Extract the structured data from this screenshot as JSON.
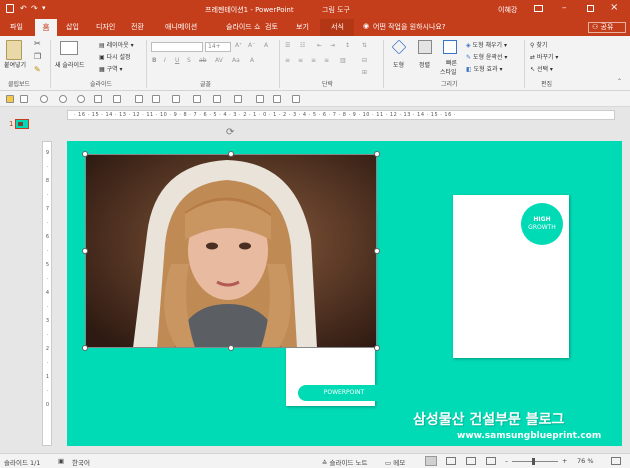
{
  "title": {
    "doc_title": "프레젠테이션1 - PowerPoint",
    "context_tab": "그림 도구",
    "user": "이혜강"
  },
  "tabs": {
    "file": "파일",
    "home": "홈",
    "insert": "삽입",
    "design": "디자인",
    "transitions": "전환",
    "animations": "애니메이션",
    "slideshow": "슬라이드 쇼",
    "review": "검토",
    "view": "보기",
    "format": "서식",
    "tell_me": "어떤 작업을 원하시나요?",
    "share": "공유"
  },
  "ribbon": {
    "clipboard": {
      "paste": "붙여넣기",
      "label": "클립보드"
    },
    "slides": {
      "new_slide": "새 슬라이드",
      "layout": "레이아웃",
      "reset": "다시 설정",
      "section": "구역",
      "label": "슬라이드"
    },
    "font": {
      "size": "14+",
      "label": "글꼴"
    },
    "paragraph": {
      "label": "단락"
    },
    "drawing": {
      "shapes": "도형",
      "arrange": "정렬",
      "quick_styles_1": "빠른",
      "quick_styles_2": "스타일",
      "fill": "도형 채우기",
      "outline": "도형 윤곽선",
      "effects": "도형 효과",
      "label": "그리기"
    },
    "editing": {
      "find": "찾기",
      "replace": "바꾸기",
      "select": "선택",
      "label": "편집"
    }
  },
  "thumbnail": {
    "number": "1"
  },
  "slide": {
    "badge_line1": "HIGH",
    "badge_line2": "GROWTH",
    "button_label": "POWERPOINT"
  },
  "watermark": {
    "line1": "삼성물산 건설부문 블로그",
    "line2": "www.samsungblueprint.com"
  },
  "status": {
    "slide_info": "슬라이드 1/1",
    "language": "한국어",
    "notes": "슬라이드 노트",
    "comments": "메모",
    "zoom": "76 %"
  },
  "colors": {
    "accent": "#c43e1c",
    "slide_bg": "#00dbb6"
  }
}
